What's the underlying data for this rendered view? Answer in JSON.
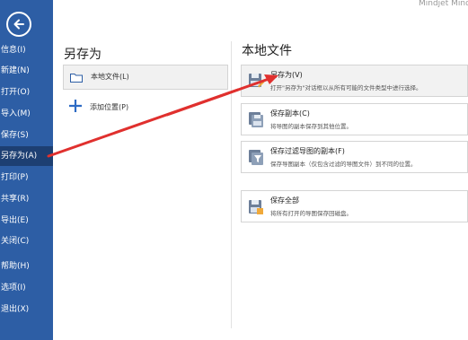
{
  "app": {
    "watermark": "Mindjet Mind"
  },
  "sidebar": {
    "items": [
      {
        "label": "信息(I)"
      },
      {
        "label": "新建(N)"
      },
      {
        "label": "打开(O)"
      },
      {
        "label": "导入(M)"
      },
      {
        "label": "保存(S)"
      },
      {
        "label": "另存为(A)",
        "active": true
      },
      {
        "label": "打印(P)"
      },
      {
        "label": "共享(R)"
      },
      {
        "label": "导出(E)"
      },
      {
        "label": "关闭(C)"
      },
      {
        "label": "帮助(H)"
      },
      {
        "label": "选项(I)"
      },
      {
        "label": "退出(X)"
      }
    ]
  },
  "saveas": {
    "heading": "另存为",
    "local_file": "本地文件(L)",
    "add_location": "添加位置(P)"
  },
  "local": {
    "heading": "本地文件",
    "cards": [
      {
        "title": "另存为(V)",
        "desc": "打开\"另存为\"对话框以从所有可能的文件类型中进行选择。"
      },
      {
        "title": "保存副本(C)",
        "desc": "将导图的副本保存到其他位置。"
      },
      {
        "title": "保存过滤导图的副本(F)",
        "desc": "保存导图副本（仅包含过滤的导图文件）到不同的位置。"
      },
      {
        "title": "保存全部",
        "desc": "将所有打开的导图保存回磁盘。"
      }
    ]
  },
  "colors": {
    "sidebar": "#2d5ea5",
    "sidebar_active": "#1d3f72",
    "arrow": "#e0302e"
  }
}
